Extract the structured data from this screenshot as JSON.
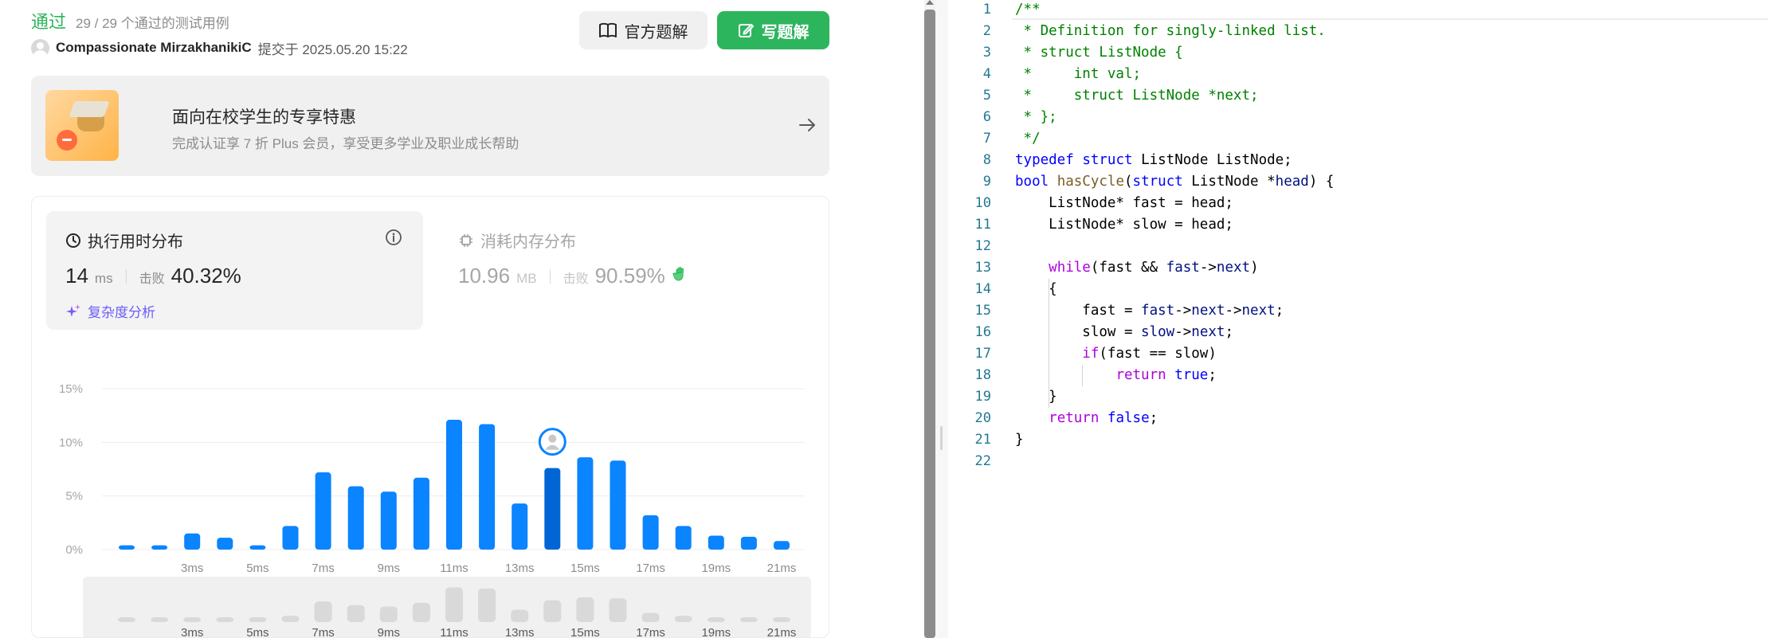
{
  "submission": {
    "status": "通过",
    "tests_passed": "29 / 29 个通过的测试用例",
    "author": "Compassionate MirzakhanikiC",
    "submitted_at": "提交于 2025.05.20 15:22"
  },
  "buttons": {
    "official_solution": "官方题解",
    "write_solution": "写题解"
  },
  "promo": {
    "title": "面向在校学生的专享特惠",
    "subtitle": "完成认证享 7 折 Plus 会员，享受更多学业及职业成长帮助"
  },
  "runtime": {
    "title": "执行用时分布",
    "value": "14",
    "unit": "ms",
    "beats_label": "击败",
    "beats_pct": "40.32%",
    "complexity_link": "复杂度分析"
  },
  "memory": {
    "title": "消耗内存分布",
    "value": "10.96",
    "unit": "MB",
    "beats_label": "击败",
    "beats_pct": "90.59%"
  },
  "colors": {
    "accent_green": "#2db55d",
    "bar_blue": "#0a84ff",
    "bar_highlight": "#0066d6",
    "link_purple": "#6b5ef8"
  },
  "chart_data": {
    "type": "bar",
    "title": "",
    "xlabel": "",
    "ylabel": "",
    "y_ticks": [
      "0%",
      "5%",
      "10%",
      "15%"
    ],
    "ylim": [
      0,
      15
    ],
    "x_tick_labels": [
      "3ms",
      "5ms",
      "7ms",
      "9ms",
      "11ms",
      "13ms",
      "15ms",
      "17ms",
      "19ms",
      "21ms"
    ],
    "categories": [
      "1ms",
      "2ms",
      "3ms",
      "4ms",
      "5ms",
      "6ms",
      "7ms",
      "8ms",
      "9ms",
      "10ms",
      "11ms",
      "12ms",
      "13ms",
      "14ms",
      "15ms",
      "16ms",
      "17ms",
      "18ms",
      "19ms",
      "20ms",
      "21ms"
    ],
    "values": [
      0.4,
      0.4,
      1.5,
      1.1,
      0.4,
      2.2,
      7.2,
      5.9,
      5.4,
      6.7,
      12.1,
      11.7,
      4.3,
      7.6,
      8.6,
      8.3,
      3.2,
      2.2,
      1.3,
      1.2,
      0.8
    ],
    "highlight_category": "14ms",
    "grid": true,
    "legend": "none"
  },
  "editor": {
    "lines": [
      {
        "n": "1",
        "tokens": [
          [
            "c",
            "/**"
          ]
        ]
      },
      {
        "n": "2",
        "tokens": [
          [
            "c",
            " * Definition for singly-linked list."
          ]
        ]
      },
      {
        "n": "3",
        "tokens": [
          [
            "c",
            " * struct ListNode {"
          ]
        ]
      },
      {
        "n": "4",
        "tokens": [
          [
            "c",
            " *     int val;"
          ]
        ]
      },
      {
        "n": "5",
        "tokens": [
          [
            "c",
            " *     struct ListNode *next;"
          ]
        ]
      },
      {
        "n": "6",
        "tokens": [
          [
            "c",
            " * };"
          ]
        ]
      },
      {
        "n": "7",
        "tokens": [
          [
            "c",
            " */"
          ]
        ]
      },
      {
        "n": "8",
        "tokens": [
          [
            "k",
            "typedef"
          ],
          [
            "p",
            " "
          ],
          [
            "k",
            "struct"
          ],
          [
            "p",
            " ListNode ListNode;"
          ]
        ]
      },
      {
        "n": "9",
        "tokens": [
          [
            "k",
            "bool"
          ],
          [
            "p",
            " "
          ],
          [
            "f",
            "hasCycle"
          ],
          [
            "p",
            "("
          ],
          [
            "k",
            "struct"
          ],
          [
            "p",
            " ListNode *"
          ],
          [
            "v",
            "head"
          ],
          [
            "p",
            ") {"
          ]
        ]
      },
      {
        "n": "10",
        "tokens": [
          [
            "p",
            "    ListNode* fast = head;"
          ]
        ]
      },
      {
        "n": "11",
        "tokens": [
          [
            "p",
            "    ListNode* slow = head;"
          ]
        ]
      },
      {
        "n": "12",
        "tokens": [
          [
            "p",
            ""
          ]
        ]
      },
      {
        "n": "13",
        "tokens": [
          [
            "p",
            "    "
          ],
          [
            "x",
            "while"
          ],
          [
            "p",
            "(fast && "
          ],
          [
            "v",
            "fast"
          ],
          [
            "p",
            "->"
          ],
          [
            "v",
            "next"
          ],
          [
            "p",
            ")"
          ]
        ]
      },
      {
        "n": "14",
        "tokens": [
          [
            "p",
            "    {"
          ]
        ]
      },
      {
        "n": "15",
        "tokens": [
          [
            "p",
            "        fast = "
          ],
          [
            "v",
            "fast"
          ],
          [
            "p",
            "->"
          ],
          [
            "v",
            "next"
          ],
          [
            "p",
            "->"
          ],
          [
            "v",
            "next"
          ],
          [
            "p",
            ";"
          ]
        ]
      },
      {
        "n": "16",
        "tokens": [
          [
            "p",
            "        slow = "
          ],
          [
            "v",
            "slow"
          ],
          [
            "p",
            "->"
          ],
          [
            "v",
            "next"
          ],
          [
            "p",
            ";"
          ]
        ]
      },
      {
        "n": "17",
        "tokens": [
          [
            "p",
            "        "
          ],
          [
            "x",
            "if"
          ],
          [
            "p",
            "(fast == slow)"
          ]
        ]
      },
      {
        "n": "18",
        "tokens": [
          [
            "p",
            "            "
          ],
          [
            "x",
            "return"
          ],
          [
            "p",
            " "
          ],
          [
            "k",
            "true"
          ],
          [
            "p",
            ";"
          ]
        ]
      },
      {
        "n": "19",
        "tokens": [
          [
            "p",
            "    }"
          ]
        ]
      },
      {
        "n": "20",
        "tokens": [
          [
            "p",
            "    "
          ],
          [
            "x",
            "return"
          ],
          [
            "p",
            " "
          ],
          [
            "k",
            "false"
          ],
          [
            "p",
            ";"
          ]
        ]
      },
      {
        "n": "21",
        "tokens": [
          [
            "p",
            "}"
          ]
        ]
      },
      {
        "n": "22",
        "tokens": [
          [
            "p",
            ""
          ]
        ]
      }
    ]
  }
}
